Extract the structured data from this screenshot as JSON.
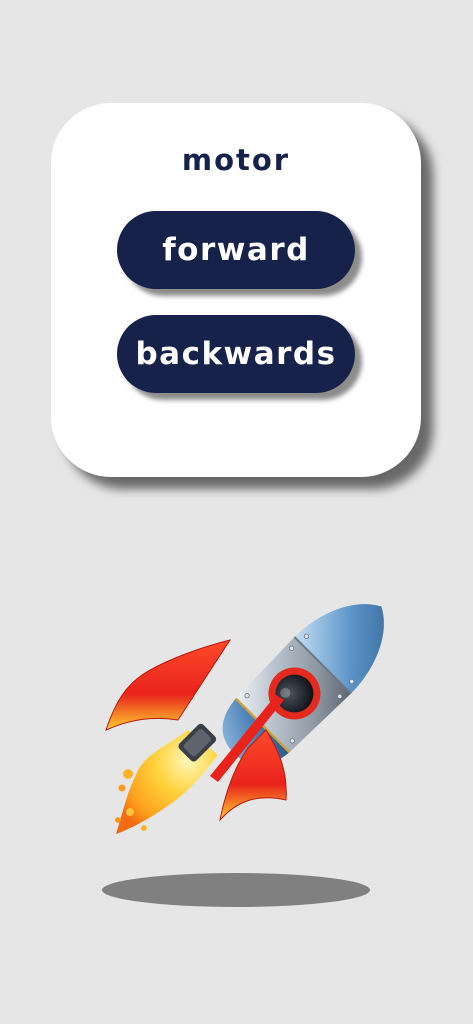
{
  "card": {
    "title": "motor",
    "buttons": {
      "forward_label": "forward",
      "backwards_label": "backwards"
    }
  },
  "illustration": {
    "icon": "rocket-icon"
  },
  "colors": {
    "background": "#e6e6e6",
    "card": "#ffffff",
    "button": "#17224a",
    "button_text": "#ffffff",
    "title": "#17224a",
    "ground_shadow": "#808080"
  }
}
